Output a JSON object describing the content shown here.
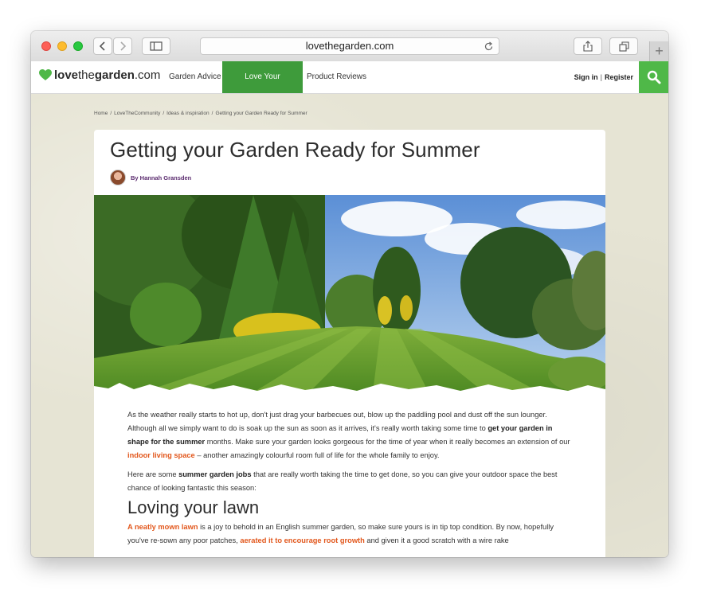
{
  "browser": {
    "url": "lovethegarden.com"
  },
  "site": {
    "logo": {
      "part1": "love",
      "part2": "the",
      "part3": "garden",
      "part4": ".com"
    },
    "nav": [
      {
        "label": "Garden Advice"
      },
      {
        "label": "Love Your Community"
      },
      {
        "label": "Product Reviews"
      }
    ],
    "sign_in": "Sign in",
    "separator": "|",
    "register": "Register",
    "accent_color": "#3e9b3b",
    "search_color": "#4fb848"
  },
  "breadcrumb": [
    "Home",
    "/",
    "LoveTheCommunity",
    "/",
    "Ideas & inspiration",
    "/",
    "Getting your Garden Ready for Summer"
  ],
  "article": {
    "title": "Getting your Garden Ready for Summer",
    "author": "By Hannah Gransden",
    "p1": {
      "t1": "As the weather really starts to hot up, don't just drag your barbecues out, blow up the paddling pool and dust off the sun lounger.  Although all we simply want to do is soak up the sun as soon as it arrives, it's really worth taking some time to ",
      "b1": "get your garden in shape for the summer",
      "t2": " months.  Make sure your garden looks gorgeous for the time of year when it really becomes an extension of our ",
      "link1": "indoor living space",
      "t3": " – another amazingly colourful room full of life for the whole family to enjoy."
    },
    "p2": {
      "t1": "Here are some ",
      "b1": "summer garden jobs",
      "t2": " that are really worth taking the time to get done, so you can give your outdoor space the best chance of looking fantastic this season:"
    },
    "h2": "Loving your lawn",
    "p3": {
      "link1": "A neatly mown lawn",
      "t1": " is a joy to behold in an English summer garden, so make sure yours is in tip top condition.  By now, hopefully you've re-sown any poor patches, ",
      "link2": "aerated it to encourage root growth",
      "t2": " and given it a good scratch with a wire rake"
    }
  }
}
